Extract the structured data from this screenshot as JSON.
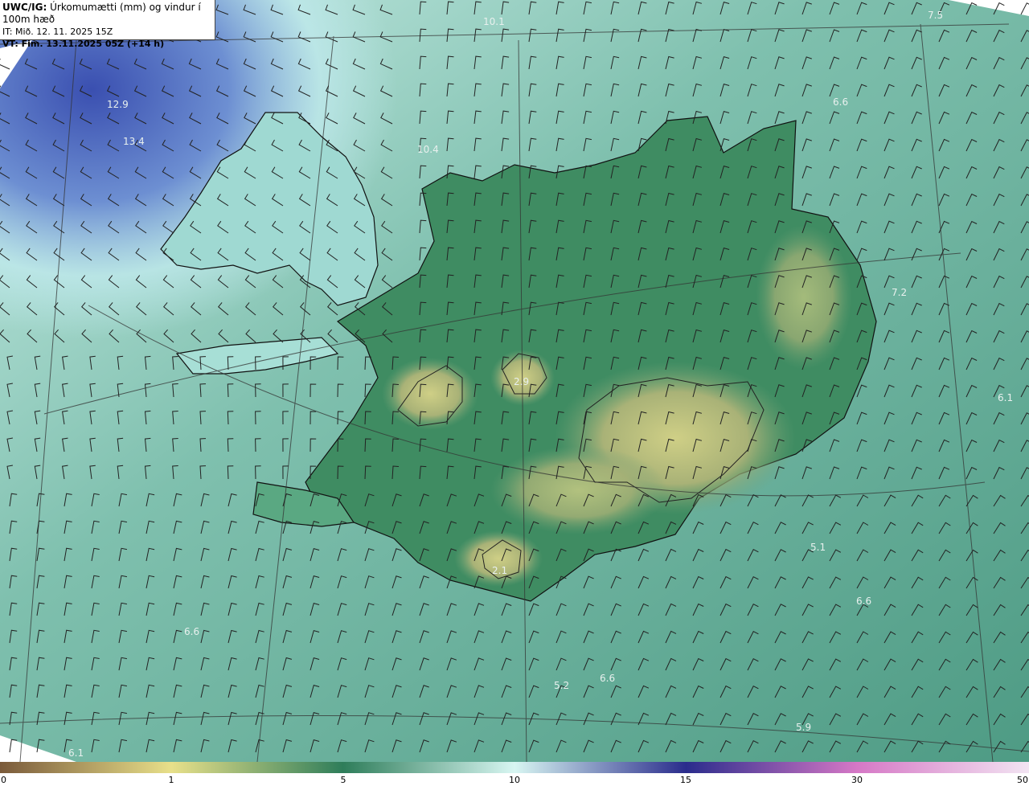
{
  "header": {
    "model": "UWC/IG:",
    "title": "Úrkomumætti (mm) og vindur í 100m hæð",
    "initial_time": "IT: Mið. 12. 11. 2025 15Z",
    "valid_time": "VT: Fim. 13.11.2025 05Z (+14 h)"
  },
  "field_values": [
    {
      "text": "10.1",
      "color": "#cfe8e6"
    },
    {
      "text": "7.5",
      "color": "#cfe8e6"
    },
    {
      "text": "12.9",
      "color": "#e8eefc"
    },
    {
      "text": "13.4",
      "color": "#e8eefc"
    },
    {
      "text": "10.4",
      "color": "#cfe8e6"
    },
    {
      "text": "6.6",
      "color": "#e8f0ee"
    },
    {
      "text": "7.2",
      "color": "#e8f0ee"
    },
    {
      "text": "2.9",
      "color": "#eef0d8"
    },
    {
      "text": "6.1",
      "color": "#e8f0ee"
    },
    {
      "text": "5.1",
      "color": "#e8f0ee"
    },
    {
      "text": "2.1",
      "color": "#eef0d8"
    },
    {
      "text": "6.6",
      "color": "#e8f0ee"
    },
    {
      "text": "6.6",
      "color": "#c9e3da"
    },
    {
      "text": "5.2",
      "color": "#e8f0ee"
    },
    {
      "text": "6.6",
      "color": "#e8f0ee"
    },
    {
      "text": "5.9",
      "color": "#e8f0ee"
    },
    {
      "text": "6.1",
      "color": "#e8f0ee"
    }
  ],
  "colorbar": {
    "ticks": [
      "0",
      "1",
      "5",
      "10",
      "15",
      "30",
      "50"
    ],
    "stops": [
      {
        "value": 0,
        "color": "#7a5a3a"
      },
      {
        "value": 1,
        "color": "#e8e08a"
      },
      {
        "value": 5,
        "color": "#2e7d5a"
      },
      {
        "value": 10,
        "color": "#d8f6f2"
      },
      {
        "value": 15,
        "color": "#2a2c8c"
      },
      {
        "value": 30,
        "color": "#d678c6"
      },
      {
        "value": 50,
        "color": "#f2e4f2"
      }
    ]
  },
  "colors": {
    "ocean_blue": "#3d56b0",
    "ocean_teal": "#5fa895",
    "land_green": "#3f8c62",
    "land_yellow": "#c8c87e",
    "coast": "#111111"
  }
}
